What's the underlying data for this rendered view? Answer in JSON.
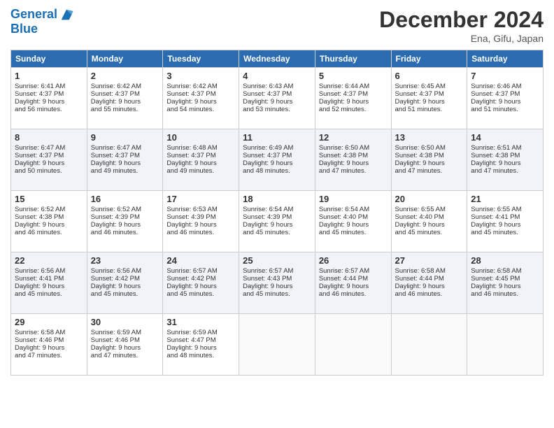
{
  "header": {
    "logo_line1": "General",
    "logo_line2": "Blue",
    "month_title": "December 2024",
    "location": "Ena, Gifu, Japan"
  },
  "weekdays": [
    "Sunday",
    "Monday",
    "Tuesday",
    "Wednesday",
    "Thursday",
    "Friday",
    "Saturday"
  ],
  "days": [
    {
      "num": "",
      "info": ""
    },
    {
      "num": "",
      "info": ""
    },
    {
      "num": "",
      "info": ""
    },
    {
      "num": "",
      "info": ""
    },
    {
      "num": "",
      "info": ""
    },
    {
      "num": "",
      "info": ""
    },
    {
      "num": "",
      "info": ""
    },
    {
      "num": "1",
      "info": "Sunrise: 6:41 AM\nSunset: 4:37 PM\nDaylight: 9 hours\nand 56 minutes."
    },
    {
      "num": "2",
      "info": "Sunrise: 6:42 AM\nSunset: 4:37 PM\nDaylight: 9 hours\nand 55 minutes."
    },
    {
      "num": "3",
      "info": "Sunrise: 6:42 AM\nSunset: 4:37 PM\nDaylight: 9 hours\nand 54 minutes."
    },
    {
      "num": "4",
      "info": "Sunrise: 6:43 AM\nSunset: 4:37 PM\nDaylight: 9 hours\nand 53 minutes."
    },
    {
      "num": "5",
      "info": "Sunrise: 6:44 AM\nSunset: 4:37 PM\nDaylight: 9 hours\nand 52 minutes."
    },
    {
      "num": "6",
      "info": "Sunrise: 6:45 AM\nSunset: 4:37 PM\nDaylight: 9 hours\nand 51 minutes."
    },
    {
      "num": "7",
      "info": "Sunrise: 6:46 AM\nSunset: 4:37 PM\nDaylight: 9 hours\nand 51 minutes."
    },
    {
      "num": "8",
      "info": "Sunrise: 6:47 AM\nSunset: 4:37 PM\nDaylight: 9 hours\nand 50 minutes."
    },
    {
      "num": "9",
      "info": "Sunrise: 6:47 AM\nSunset: 4:37 PM\nDaylight: 9 hours\nand 49 minutes."
    },
    {
      "num": "10",
      "info": "Sunrise: 6:48 AM\nSunset: 4:37 PM\nDaylight: 9 hours\nand 49 minutes."
    },
    {
      "num": "11",
      "info": "Sunrise: 6:49 AM\nSunset: 4:37 PM\nDaylight: 9 hours\nand 48 minutes."
    },
    {
      "num": "12",
      "info": "Sunrise: 6:50 AM\nSunset: 4:38 PM\nDaylight: 9 hours\nand 47 minutes."
    },
    {
      "num": "13",
      "info": "Sunrise: 6:50 AM\nSunset: 4:38 PM\nDaylight: 9 hours\nand 47 minutes."
    },
    {
      "num": "14",
      "info": "Sunrise: 6:51 AM\nSunset: 4:38 PM\nDaylight: 9 hours\nand 47 minutes."
    },
    {
      "num": "15",
      "info": "Sunrise: 6:52 AM\nSunset: 4:38 PM\nDaylight: 9 hours\nand 46 minutes."
    },
    {
      "num": "16",
      "info": "Sunrise: 6:52 AM\nSunset: 4:39 PM\nDaylight: 9 hours\nand 46 minutes."
    },
    {
      "num": "17",
      "info": "Sunrise: 6:53 AM\nSunset: 4:39 PM\nDaylight: 9 hours\nand 46 minutes."
    },
    {
      "num": "18",
      "info": "Sunrise: 6:54 AM\nSunset: 4:39 PM\nDaylight: 9 hours\nand 45 minutes."
    },
    {
      "num": "19",
      "info": "Sunrise: 6:54 AM\nSunset: 4:40 PM\nDaylight: 9 hours\nand 45 minutes."
    },
    {
      "num": "20",
      "info": "Sunrise: 6:55 AM\nSunset: 4:40 PM\nDaylight: 9 hours\nand 45 minutes."
    },
    {
      "num": "21",
      "info": "Sunrise: 6:55 AM\nSunset: 4:41 PM\nDaylight: 9 hours\nand 45 minutes."
    },
    {
      "num": "22",
      "info": "Sunrise: 6:56 AM\nSunset: 4:41 PM\nDaylight: 9 hours\nand 45 minutes."
    },
    {
      "num": "23",
      "info": "Sunrise: 6:56 AM\nSunset: 4:42 PM\nDaylight: 9 hours\nand 45 minutes."
    },
    {
      "num": "24",
      "info": "Sunrise: 6:57 AM\nSunset: 4:42 PM\nDaylight: 9 hours\nand 45 minutes."
    },
    {
      "num": "25",
      "info": "Sunrise: 6:57 AM\nSunset: 4:43 PM\nDaylight: 9 hours\nand 45 minutes."
    },
    {
      "num": "26",
      "info": "Sunrise: 6:57 AM\nSunset: 4:44 PM\nDaylight: 9 hours\nand 46 minutes."
    },
    {
      "num": "27",
      "info": "Sunrise: 6:58 AM\nSunset: 4:44 PM\nDaylight: 9 hours\nand 46 minutes."
    },
    {
      "num": "28",
      "info": "Sunrise: 6:58 AM\nSunset: 4:45 PM\nDaylight: 9 hours\nand 46 minutes."
    },
    {
      "num": "29",
      "info": "Sunrise: 6:58 AM\nSunset: 4:46 PM\nDaylight: 9 hours\nand 47 minutes."
    },
    {
      "num": "30",
      "info": "Sunrise: 6:59 AM\nSunset: 4:46 PM\nDaylight: 9 hours\nand 47 minutes."
    },
    {
      "num": "31",
      "info": "Sunrise: 6:59 AM\nSunset: 4:47 PM\nDaylight: 9 hours\nand 48 minutes."
    },
    {
      "num": "",
      "info": ""
    },
    {
      "num": "",
      "info": ""
    },
    {
      "num": "",
      "info": ""
    },
    {
      "num": "",
      "info": ""
    }
  ]
}
